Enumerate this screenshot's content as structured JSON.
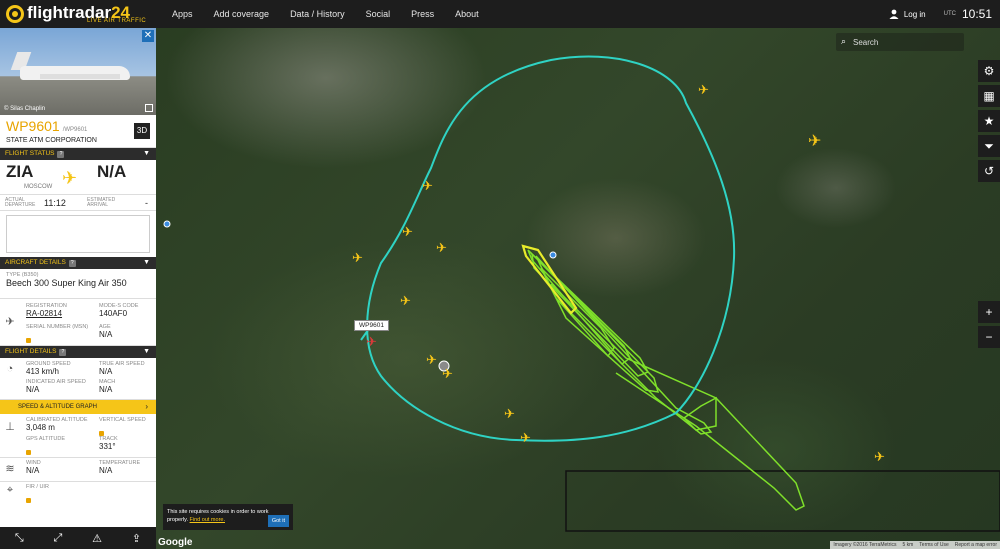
{
  "brand": {
    "name_main": "flightradar",
    "name_num": "24",
    "tagline": "LIVE AIR TRAFFIC"
  },
  "nav": [
    "Apps",
    "Add coverage",
    "Data / History",
    "Social",
    "Press",
    "About"
  ],
  "header": {
    "login": "Log in",
    "tz": "UTC",
    "clock": "10:51"
  },
  "sidebar": {
    "photo_credit": "© Silas Chaplin",
    "callsign": "WP9601",
    "callsign_alt": "/WP9601",
    "airline": "STATE ATM CORPORATION",
    "btn_3d": "3D",
    "flight_status_title": "FLIGHT STATUS",
    "origin_code": "ZIA",
    "origin_city": "MOSCOW",
    "dest_code": "N/A",
    "actual_label": "ACTUAL DEPARTURE",
    "departure_time": "11:12",
    "estimated_label": "ESTIMATED ARRIVAL",
    "arrival_time": "-",
    "aircraft_details_title": "AIRCRAFT DETAILS",
    "type_label": "TYPE",
    "type_code": "(B350)",
    "aircraft_model": "Beech 300 Super King Air 350",
    "registration_label": "REGISTRATION",
    "registration": "RA-02814",
    "modes_label": "MODE-S CODE",
    "modes": "140AF0",
    "serial_label": "SERIAL NUMBER (MSN)",
    "age_label": "AGE",
    "age": "N/A",
    "flight_details_title": "FLIGHT DETAILS",
    "ground_speed_label": "GROUND SPEED",
    "ground_speed": "413 km/h",
    "true_air_speed_label": "TRUE AIR SPEED",
    "true_air_speed": "N/A",
    "ias_label": "INDICATED AIR SPEED",
    "ias": "N/A",
    "mach_label": "MACH",
    "mach": "N/A",
    "speed_graph": "SPEED & ALTITUDE GRAPH",
    "cal_alt_label": "CALIBRATED ALTITUDE",
    "cal_alt": "3,048 m",
    "vs_label": "VERTICAL SPEED",
    "gps_alt_label": "GPS ALTITUDE",
    "track_label": "TRACK",
    "track": "331°",
    "wind_label": "WIND",
    "wind": "N/A",
    "temp_label": "TEMPERATURE",
    "temp": "N/A",
    "fir_label": "FIR / UIR"
  },
  "map": {
    "search_placeholder": "Search",
    "flight_tag": "WP9601",
    "cookie_text": "This site requires cookies in order to work properly.",
    "cookie_link": "Find out more.",
    "cookie_btn": "Got it",
    "google": "Google",
    "attribution": [
      "Imagery ©2016 TerraMetrics",
      "5 km",
      "Terms of Use",
      "Report a map error"
    ],
    "colors": {
      "track_cyan": "#2fd3c4",
      "track_green": "#7fe02a",
      "track_yellow": "#e8ec2a",
      "plane_yellow": "#f5c518"
    },
    "right_tools": [
      "gear-icon",
      "grid-icon",
      "star-icon",
      "filter-icon",
      "history-icon"
    ]
  }
}
